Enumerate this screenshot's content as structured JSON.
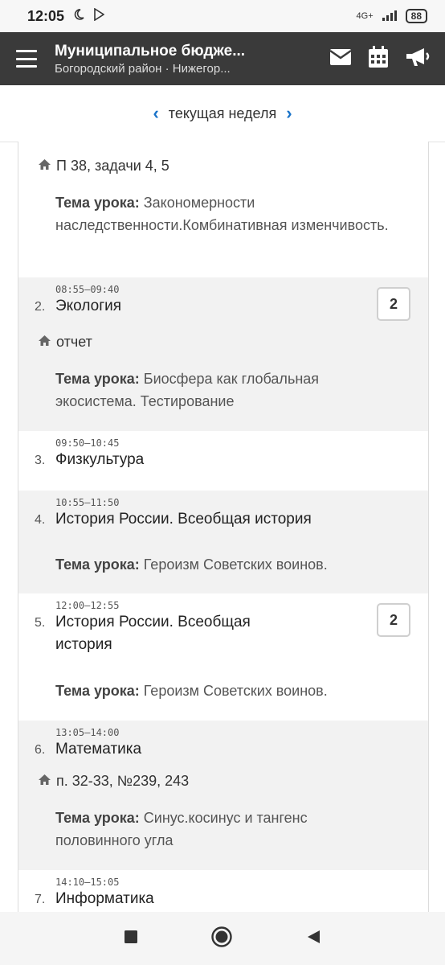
{
  "status": {
    "time": "12:05",
    "network": "4G+",
    "battery": "88"
  },
  "appbar": {
    "title": "Муниципальное бюдже...",
    "subtitle": "Богородский район · Нижегор..."
  },
  "week": {
    "label": "текущая неделя"
  },
  "first": {
    "homework": "П 38, задачи 4, 5",
    "topic_label": "Тема урока:",
    "topic": "Закономерности наследственности.Комбинативная изменчивость."
  },
  "lessons": [
    {
      "time": "08:55–09:40",
      "num": "2.",
      "subject": "Экология",
      "grade": "2",
      "homework": "отчет",
      "topic_label": "Тема урока:",
      "topic": "Биосфера как глобальная экосистема. Тестирование"
    },
    {
      "time": "09:50–10:45",
      "num": "3.",
      "subject": "Физкультура"
    },
    {
      "time": "10:55–11:50",
      "num": "4.",
      "subject": "История России. Всеобщая история",
      "topic_label": "Тема урока:",
      "topic": "Героизм Советских воинов."
    },
    {
      "time": "12:00–12:55",
      "num": "5.",
      "subject": "История России. Всеобщая история",
      "grade": "2",
      "topic_label": "Тема урока:",
      "topic": "Героизм Советских воинов."
    },
    {
      "time": "13:05–14:00",
      "num": "6.",
      "subject": "Математика",
      "homework": "п. 32-33, №239, 243",
      "topic_label": "Тема урока:",
      "topic": "Синус.косинус и тангенс половинного угла"
    },
    {
      "time": "14:10–15:05",
      "num": "7.",
      "subject": "Информатика"
    }
  ]
}
